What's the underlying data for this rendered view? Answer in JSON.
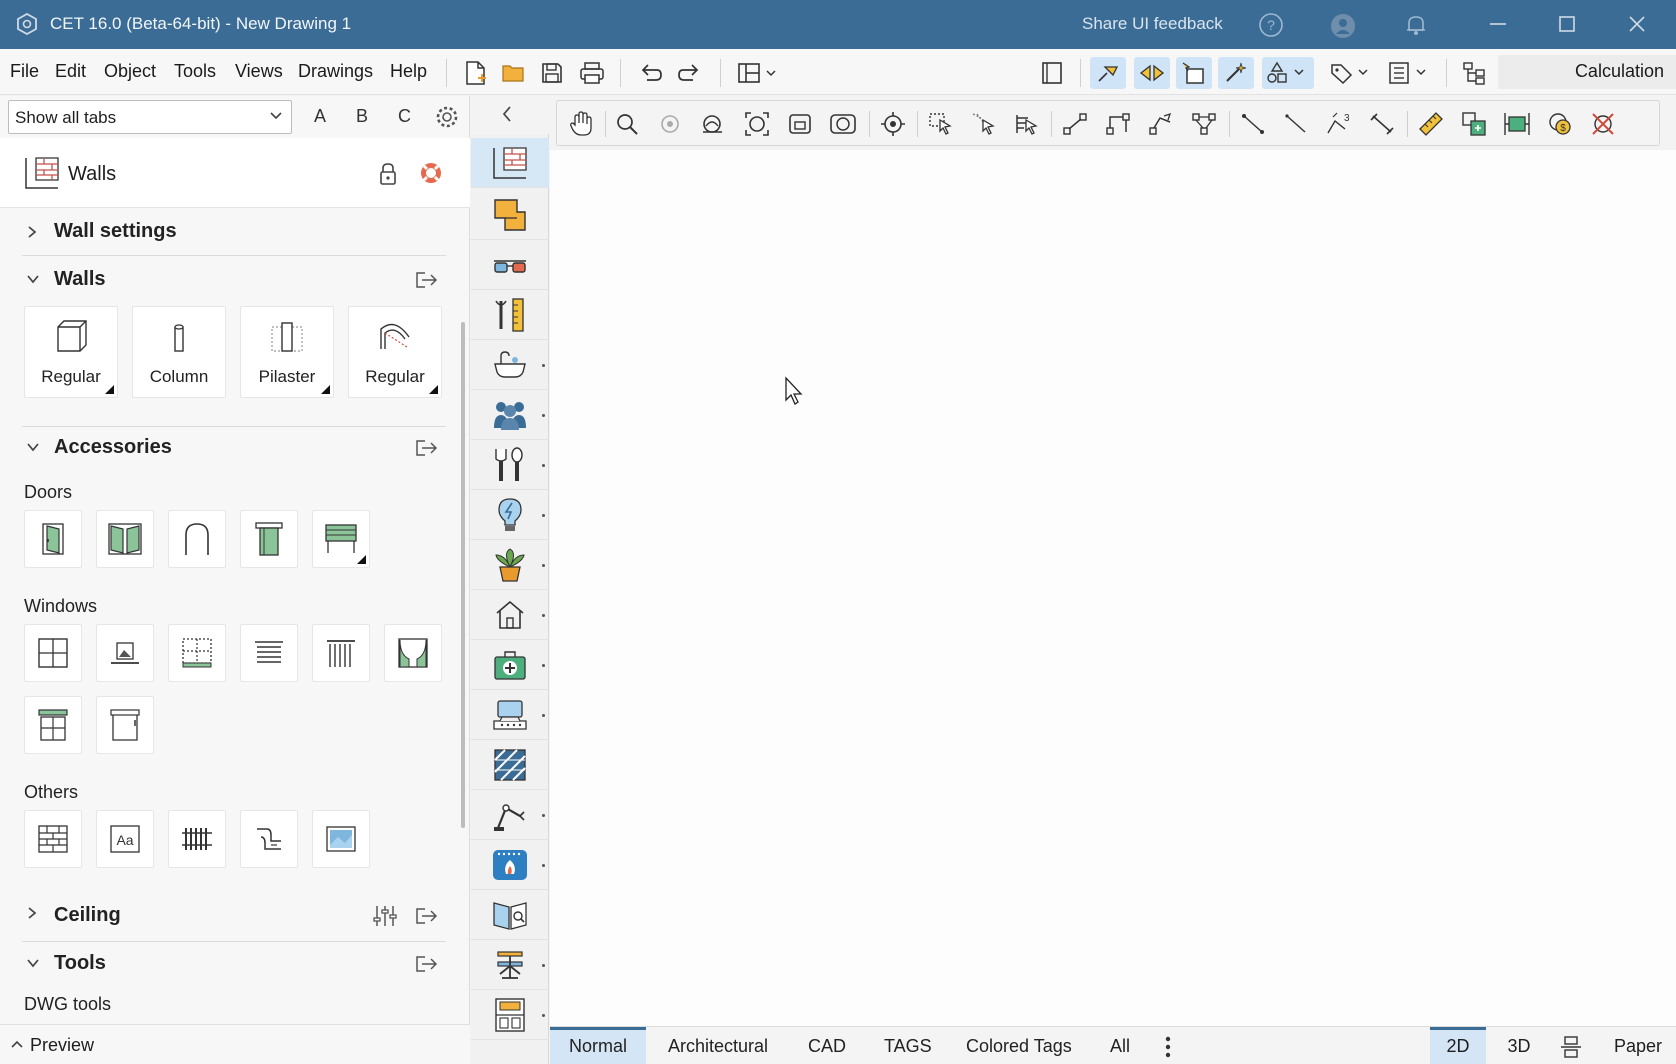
{
  "titlebar": {
    "title": "CET 16.0 (Beta-64-bit) - New Drawing 1",
    "feedback": "Share UI feedback"
  },
  "menu": {
    "items": [
      "File",
      "Edit",
      "Object",
      "Tools",
      "Views",
      "Drawings",
      "Help"
    ],
    "calculation": "Calculation"
  },
  "panel": {
    "tab_filter": "Show all tabs",
    "filters": [
      "A",
      "B",
      "C"
    ],
    "title": "Walls",
    "sections": {
      "wall_settings": "Wall settings",
      "walls": "Walls",
      "accessories": "Accessories",
      "ceiling": "Ceiling",
      "tools": "Tools"
    },
    "wall_tiles": [
      "Regular",
      "Column",
      "Pilaster",
      "Regular"
    ],
    "subheads": {
      "doors": "Doors",
      "windows": "Windows",
      "others": "Others",
      "dwg": "DWG tools"
    },
    "preview": "Preview"
  },
  "bottom": {
    "tabs": [
      "Normal",
      "Architectural",
      "CAD",
      "TAGS",
      "Colored Tags",
      "All"
    ],
    "views": [
      "2D",
      "3D",
      "Paper"
    ]
  },
  "colors": {
    "titlebar": "#3b6c96",
    "active_tab": "#d4e5f5",
    "door_green": "#8cc49a"
  }
}
